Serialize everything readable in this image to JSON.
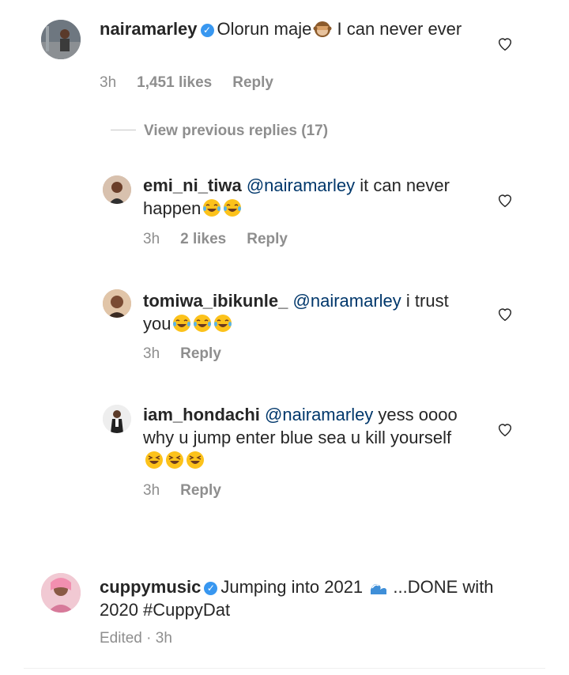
{
  "comments": [
    {
      "username": "nairamarley",
      "verified": true,
      "text_before": "Olorun maje",
      "emoji": "see-no-evil-monkey",
      "text_after": " I can never ever",
      "time": "3h",
      "likes": "1,451 likes",
      "reply": "Reply"
    },
    {
      "username": "cuppymusic",
      "verified": true,
      "text_before": "Jumping into 2021",
      "emoji": "water-wave",
      "text_after": " ...DONE with 2020 #CuppyDat",
      "edited": "Edited · 3h"
    }
  ],
  "view_replies": "View previous replies (17)",
  "replies": [
    {
      "username": "emi_ni_tiwa",
      "mention": "@nairamarley",
      "text": " it can never happen",
      "emojis": [
        "tears-of-joy",
        "tears-of-joy"
      ],
      "time": "3h",
      "likes": "2 likes",
      "reply": "Reply"
    },
    {
      "username": "tomiwa_ibikunle_",
      "mention": "@nairamarley",
      "text": " i trust you",
      "emojis": [
        "tears-of-joy",
        "tears-of-joy",
        "tears-of-joy"
      ],
      "time": "3h",
      "reply": "Reply"
    },
    {
      "username": "iam_hondachi",
      "mention": "@nairamarley",
      "text": " yess oooo why u jump enter blue sea u kill yourself ",
      "emojis": [
        "laughing-squint",
        "laughing-squint",
        "laughing-squint"
      ],
      "time": "3h",
      "reply": "Reply"
    }
  ],
  "colors": {
    "verified": "#3897f0",
    "mention": "#00376b",
    "meta": "#8e8e8e",
    "text": "#262626"
  }
}
